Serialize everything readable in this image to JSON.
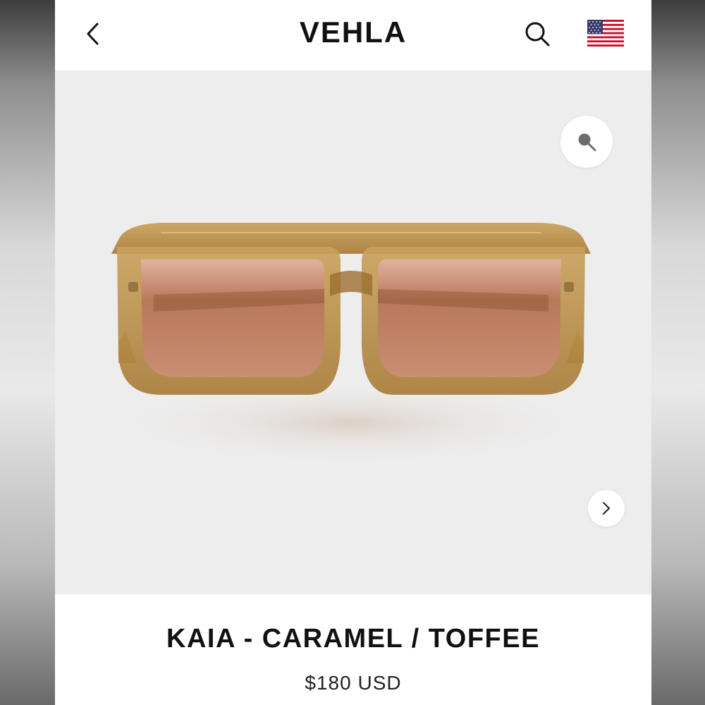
{
  "header": {
    "brand": "VEHLA",
    "back_icon": "chevron-left-icon",
    "search_icon": "search-icon",
    "flag_icon": "us-flag-icon"
  },
  "gallery": {
    "zoom_icon": "magnifier-icon",
    "next_icon": "chevron-right-icon"
  },
  "product": {
    "title": "KAIA - CARAMEL / TOFFEE",
    "price": "$180 USD"
  },
  "colors": {
    "frame": "#b8893f",
    "lens": "#c98a6a",
    "gallery_bg": "#ededed"
  }
}
